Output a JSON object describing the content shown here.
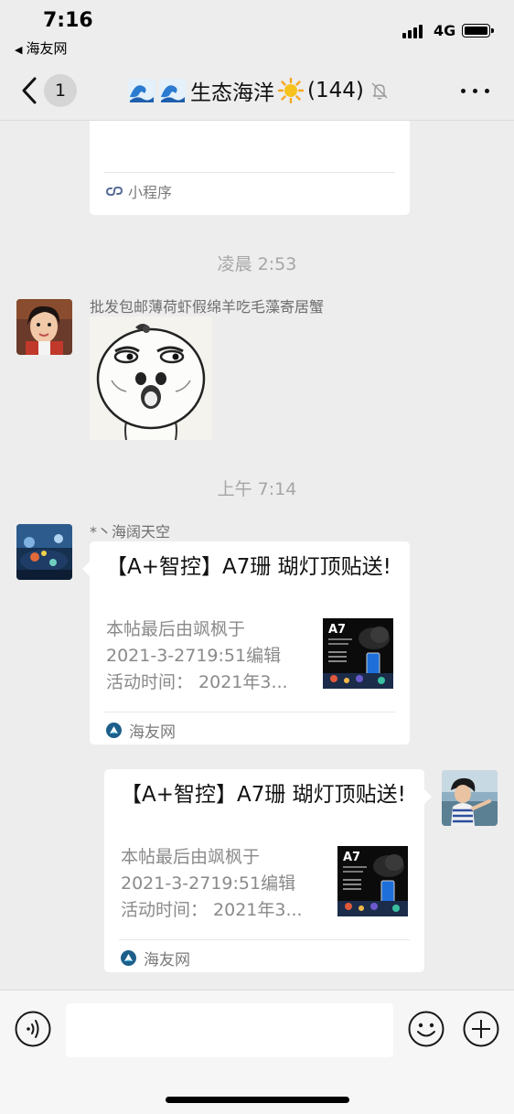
{
  "status_bar": {
    "time": "7:16",
    "back_app": "海友网",
    "network": "4G"
  },
  "nav": {
    "unread_count": "1",
    "group_name": "生态海洋",
    "member_count": "(144)"
  },
  "messages": {
    "mini_program_card": {
      "footer_label": "小程序"
    },
    "timestamp_1": "凌晨 2:53",
    "msg1": {
      "sender": "批发包邮薄荷虾假绵羊吃毛藻寄居蟹",
      "type": "sticker"
    },
    "timestamp_2": "上午 7:14",
    "msg2": {
      "sender": "*丶海阔天空",
      "title": "【A+智控】A7珊 瑚灯顶贴送!",
      "desc_lines": [
        "本帖最后由飒枫于",
        "2021-3-2719:51编辑",
        "活动时间：  2021年3..."
      ],
      "thumb_label": "A7",
      "source": "海友网"
    },
    "msg3": {
      "title": "【A+智控】A7珊 瑚灯顶贴送!",
      "desc_lines": [
        "本帖最后由飒枫于",
        "2021-3-2719:51编辑",
        "活动时间：  2021年3..."
      ],
      "thumb_label": "A7",
      "source": "海友网"
    }
  },
  "input_bar": {
    "placeholder": ""
  },
  "colors": {
    "background": "#ededed",
    "bubble": "#ffffff",
    "timestamp": "#a6a6a6",
    "link_icon": "#576b95"
  }
}
